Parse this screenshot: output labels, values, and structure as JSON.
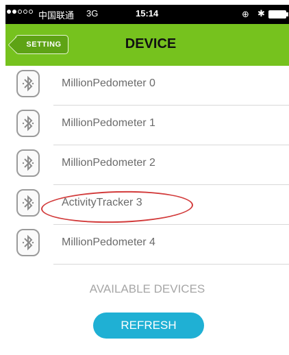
{
  "status_bar": {
    "carrier": "中国联通",
    "network": "3G",
    "time": "15:14"
  },
  "nav": {
    "back_label": "SETTING",
    "title": "DEVICE"
  },
  "devices": [
    {
      "name": "MillionPedometer 0"
    },
    {
      "name": "MillionPedometer 1"
    },
    {
      "name": "MillionPedometer 2"
    },
    {
      "name": "ActivityTracker 3"
    },
    {
      "name": "MillionPedometer 4"
    }
  ],
  "highlighted_device": "ActivityTracker 3",
  "available_label": "AVAILABLE DEVICES",
  "refresh_label": "REFRESH",
  "colors": {
    "nav_green": "#76c21e",
    "refresh_blue": "#1fb0d4",
    "highlight_red": "#d23a3a"
  },
  "icons": [
    "lock-icon",
    "bluetooth-icon",
    "battery-icon",
    "bluetooth-device-icon"
  ]
}
